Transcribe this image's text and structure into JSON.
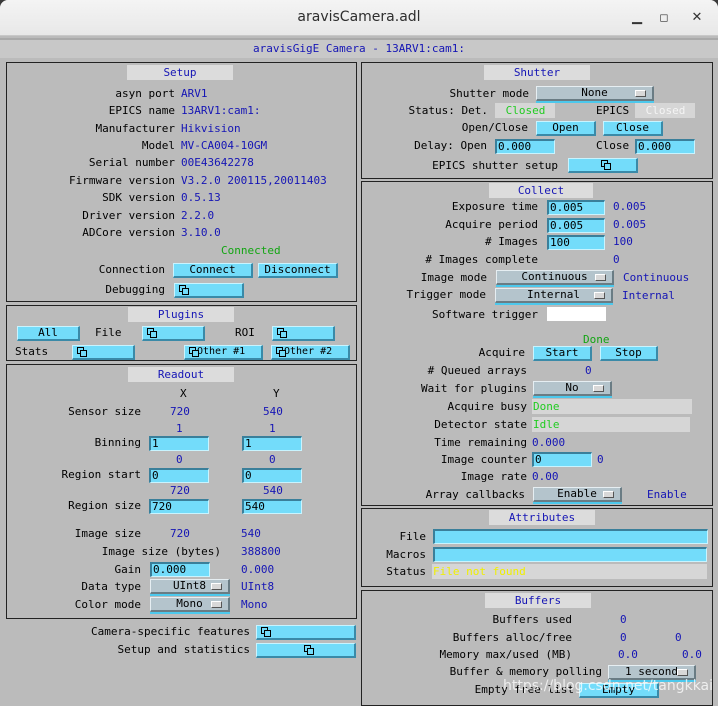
{
  "window": {
    "title": "aravisCamera.adl",
    "minimize": "minimize-icon",
    "maximize": "maximize-icon",
    "close": "close-icon"
  },
  "header": "aravisGigE Camera - 13ARV1:cam1:",
  "setup": {
    "title": "Setup",
    "rows": [
      {
        "label": "asyn port",
        "value": "ARV1"
      },
      {
        "label": "EPICS name",
        "value": "13ARV1:cam1:"
      },
      {
        "label": "Manufacturer",
        "value": "Hikvision"
      },
      {
        "label": "Model",
        "value": "MV-CA004-10GM"
      },
      {
        "label": "Serial number",
        "value": "00E43642278"
      },
      {
        "label": "Firmware version",
        "value": "V3.2.0 200115,20011403"
      },
      {
        "label": "SDK version",
        "value": "0.5.13"
      },
      {
        "label": "Driver version",
        "value": "2.2.0"
      },
      {
        "label": "ADCore version",
        "value": "3.10.0"
      }
    ],
    "connection_status": "Connected",
    "connection_label": "Connection",
    "connect_button": "Connect",
    "disconnect_button": "Disconnect",
    "debugging_label": "Debugging"
  },
  "plugins": {
    "title": "Plugins",
    "all_button": "All",
    "file_label": "File",
    "roi_label": "ROI",
    "stats_label": "Stats",
    "other1": "Other #1",
    "other2": "Other #2"
  },
  "readout": {
    "title": "Readout",
    "col_x": "X",
    "col_y": "Y",
    "sensor_size": {
      "label": "Sensor size",
      "x": "720",
      "y": "540"
    },
    "binning": {
      "label": "Binning",
      "x_rbv": "1",
      "y_rbv": "1",
      "x_input": "1",
      "y_input": "1"
    },
    "region_start": {
      "label": "Region start",
      "x_rbv": "0",
      "y_rbv": "0",
      "x_input": "0",
      "y_input": "0"
    },
    "region_size": {
      "label": "Region size",
      "x_rbv": "720",
      "y_rbv": "540",
      "x_input": "720",
      "y_input": "540"
    },
    "image_size": {
      "label": "Image size",
      "x": "720",
      "y": "540"
    },
    "image_size_bytes": {
      "label": "Image size (bytes)",
      "value": "388800"
    },
    "gain": {
      "label": "Gain",
      "input": "0.000",
      "value": "0.000"
    },
    "data_type": {
      "label": "Data type",
      "selected": "UInt8",
      "value": "UInt8"
    },
    "color_mode": {
      "label": "Color mode",
      "selected": "Mono",
      "value": "Mono"
    }
  },
  "extras": {
    "camera_specific_label": "Camera-specific features",
    "setup_stats_label": "Setup and statistics"
  },
  "shutter": {
    "title": "Shutter",
    "mode_label": "Shutter mode",
    "mode_selected": "None",
    "status_label": "Status: Det.",
    "det_status": "Closed",
    "epics_label": "EPICS",
    "epics_status": "Closed",
    "open_close_label": "Open/Close",
    "open_button": "Open",
    "close_button": "Close",
    "delay_open_label": "Delay: Open",
    "delay_open_value": "0.000",
    "delay_close_label": "Close",
    "delay_close_value": "0.000",
    "epics_setup_label": "EPICS shutter setup"
  },
  "collect": {
    "title": "Collect",
    "exposure": {
      "label": "Exposure time",
      "input": "0.005",
      "value": "0.005"
    },
    "period": {
      "label": "Acquire period",
      "input": "0.005",
      "value": "0.005"
    },
    "images": {
      "label": "# Images",
      "input": "100",
      "value": "100"
    },
    "images_complete": {
      "label": "# Images complete",
      "value": "0"
    },
    "image_mode": {
      "label": "Image mode",
      "selected": "Continuous",
      "value": "Continuous"
    },
    "trigger_mode": {
      "label": "Trigger mode",
      "selected": "Internal",
      "value": "Internal"
    },
    "software_trigger_label": "Software trigger",
    "acquire_status": "Done",
    "acquire_label": "Acquire",
    "start_button": "Start",
    "stop_button": "Stop",
    "queued": {
      "label": "# Queued arrays",
      "value": "0"
    },
    "wait_plugins": {
      "label": "Wait for plugins",
      "selected": "No"
    },
    "acquire_busy": {
      "label": "Acquire busy",
      "value": "Done"
    },
    "detector_state": {
      "label": "Detector state",
      "value": "Idle"
    },
    "time_remaining": {
      "label": "Time remaining",
      "value": "0.000"
    },
    "image_counter": {
      "label": "Image counter",
      "input": "0",
      "value": "0"
    },
    "image_rate": {
      "label": "Image rate",
      "value": "0.00"
    },
    "array_callbacks": {
      "label": "Array callbacks",
      "selected": "Enable",
      "value": "Enable"
    }
  },
  "attributes": {
    "title": "Attributes",
    "file_label": "File",
    "file_value": "",
    "macros_label": "Macros",
    "macros_value": "",
    "status_label": "Status",
    "status_value": "File not found"
  },
  "buffers": {
    "title": "Buffers",
    "used": {
      "label": "Buffers used",
      "value": "0"
    },
    "alloc_free": {
      "label": "Buffers alloc/free",
      "alloc": "0",
      "free": "0"
    },
    "memory": {
      "label": "Memory max/used (MB)",
      "max": "0.0",
      "used": "0.0"
    },
    "polling": {
      "label": "Buffer & memory polling",
      "selected": "1 second"
    },
    "empty": {
      "label": "Empty free list",
      "button": "Empty"
    }
  },
  "watermark": "https://blog.csdn.net/tangkkai",
  "colors": {
    "background": "#bbbbbb",
    "label_blue": "#1515b5",
    "status_green": "#12a512",
    "widget_cyan": "#73dcfa",
    "status_yellow": "#f0f000"
  }
}
